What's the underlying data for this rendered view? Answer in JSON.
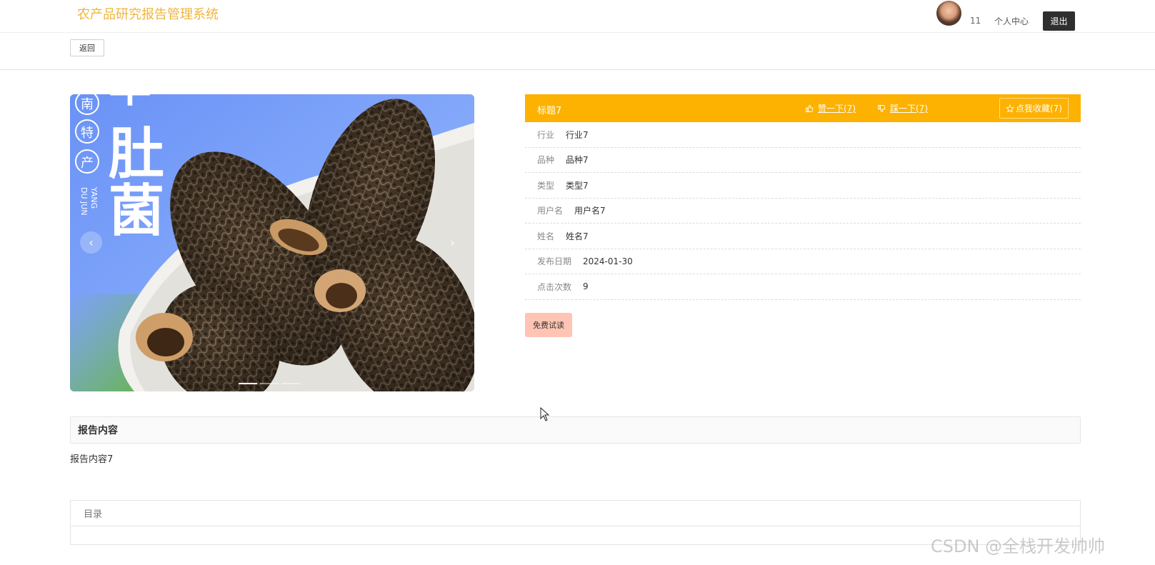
{
  "header": {
    "brand": "农产品研究报告管理系统",
    "user_name": "11",
    "user_center": "个人中心",
    "logout": "退出"
  },
  "back_label": "返回",
  "carousel": {
    "slide_count": 3,
    "active_index": 0,
    "prev_glyph": "‹",
    "next_glyph": "›"
  },
  "detail": {
    "title": "标题7",
    "like_label": "赞一下(7)",
    "dislike_label": "踩一下(7)",
    "favorite_label": "点我收藏(7)",
    "fields": [
      {
        "label": "行业",
        "value": "行业7"
      },
      {
        "label": "品种",
        "value": "品种7"
      },
      {
        "label": "类型",
        "value": "类型7"
      },
      {
        "label": "用户名",
        "value": "用户名7"
      },
      {
        "label": "姓名",
        "value": "姓名7"
      },
      {
        "label": "发布日期",
        "value": "2024-01-30"
      },
      {
        "label": "点击次数",
        "value": "9"
      }
    ],
    "trial_label": "免费试读"
  },
  "report": {
    "header": "报告内容",
    "body": "报告内容7"
  },
  "toc": {
    "title": "目录"
  },
  "watermark": "CSDN @全栈开发帅帅",
  "colors": {
    "brand": "#f0b43c",
    "title_bar": "#fdb101",
    "trial_button": "#ffc4b3",
    "logout_button": "#2f2f2f"
  }
}
